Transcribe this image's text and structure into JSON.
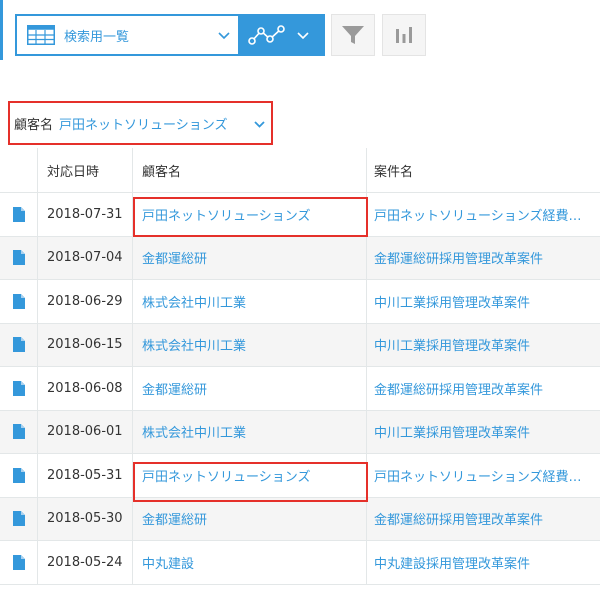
{
  "toolbar": {
    "view_label": "検索用一覧"
  },
  "filter": {
    "label": "顧客名",
    "value": "戸田ネットソリューションズ"
  },
  "table": {
    "headers": [
      "対応日時",
      "顧客名",
      "案件名"
    ],
    "rows": [
      {
        "date": "2018-07-31",
        "customer": "戸田ネットソリューションズ",
        "project": "戸田ネットソリューションズ経費精算システム導入案件"
      },
      {
        "date": "2018-07-04",
        "customer": "金都運総研",
        "project": "金都運総研採用管理改革案件"
      },
      {
        "date": "2018-06-29",
        "customer": "株式会社中川工業",
        "project": "中川工業採用管理改革案件"
      },
      {
        "date": "2018-06-15",
        "customer": "株式会社中川工業",
        "project": "中川工業採用管理改革案件"
      },
      {
        "date": "2018-06-08",
        "customer": "金都運総研",
        "project": "金都運総研採用管理改革案件"
      },
      {
        "date": "2018-06-01",
        "customer": "株式会社中川工業",
        "project": "中川工業採用管理改革案件"
      },
      {
        "date": "2018-05-31",
        "customer": "戸田ネットソリューションズ",
        "project": "戸田ネットソリューションズ経費精算システム導入案件"
      },
      {
        "date": "2018-05-30",
        "customer": "金都運総研",
        "project": "金都運総研採用管理改革案件"
      },
      {
        "date": "2018-05-24",
        "customer": "中丸建設",
        "project": "中丸建設採用管理改革案件"
      }
    ]
  },
  "colors": {
    "accent": "#3498db",
    "highlight": "#e5302a"
  }
}
